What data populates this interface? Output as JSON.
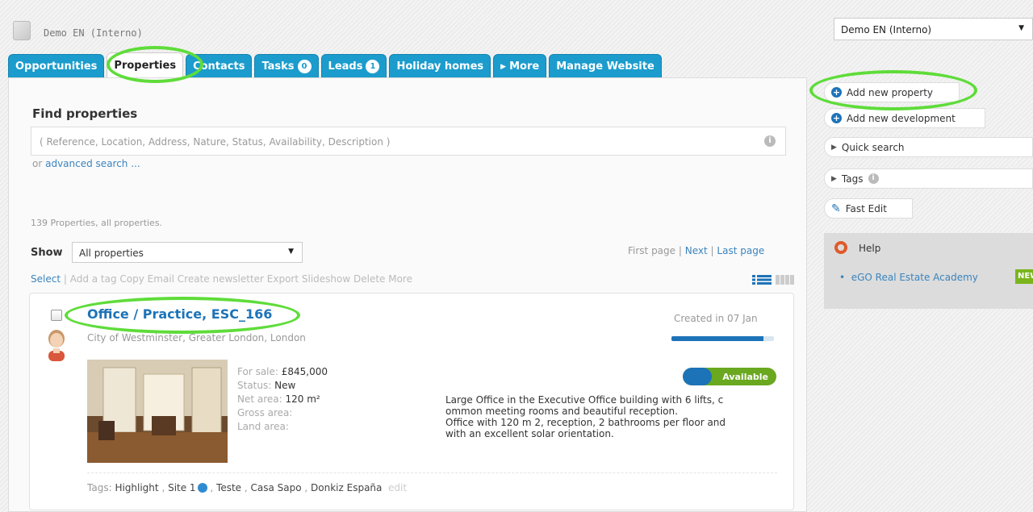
{
  "header": {
    "app_title": "Demo EN (Interno)"
  },
  "tabs": [
    {
      "label": "Opportunities"
    },
    {
      "label": "Properties"
    },
    {
      "label": "Contacts"
    },
    {
      "label": "Tasks",
      "badge": "0"
    },
    {
      "label": "Leads",
      "badge": "1"
    },
    {
      "label": "Holiday homes"
    },
    {
      "label": "More"
    },
    {
      "label": "Manage Website"
    }
  ],
  "find": {
    "title": "Find properties",
    "placeholder": "( Reference, Location, Address, Nature, Status, Availability, Description )",
    "or_text": "or",
    "advanced_link": "advanced search ..."
  },
  "listing": {
    "count_text": "139 Properties, all properties.",
    "show_label": "Show",
    "show_value": "All properties",
    "pager": {
      "first": "First page",
      "sep1": "|",
      "next": "Next",
      "sep2": "|",
      "last": "Last page"
    },
    "select_link": "Select",
    "actions_text": "| Add a tag Copy Email Create newsletter Export Slideshow Delete More"
  },
  "property": {
    "title": "Office / Practice, ESC_166",
    "location": "City of Westminster, Greater London, London",
    "created": "Created in 07 Jan",
    "completeness_percent": 90,
    "availability": "Available",
    "details": [
      {
        "label": "For sale:",
        "value": "£845,000"
      },
      {
        "label": "Status:",
        "value": "New"
      },
      {
        "label": "Net area:",
        "value": "120 m²"
      },
      {
        "label": "Gross area:",
        "value": ""
      },
      {
        "label": "Land area:",
        "value": ""
      }
    ],
    "description_lines": [
      "Large Office in the Executive Office building with 6 lifts, c",
      "ommon meeting rooms and beautiful reception.",
      "Office with 120 m 2, reception, 2 bathrooms per floor and",
      "with an excellent solar orientation."
    ],
    "tags_label": "Tags:",
    "tags": [
      "Highlight",
      "Site 1",
      "Teste",
      "Casa Sapo",
      "Donkiz España"
    ],
    "tags_edit": "edit"
  },
  "sidebar": {
    "workspace_select": "Demo EN (Interno)",
    "add_property": "Add new property",
    "add_development": "Add new development",
    "quick_search": "Quick search",
    "tags": "Tags",
    "fast_edit": "Fast Edit",
    "help": "Help",
    "academy": "eGO Real Estate Academy",
    "new_badge": "NEW"
  },
  "colors": {
    "tab_blue": "#1b9ccd",
    "link_blue": "#1d73b8",
    "available_green": "#6aa820",
    "highlight_green": "#5fdc3a"
  }
}
